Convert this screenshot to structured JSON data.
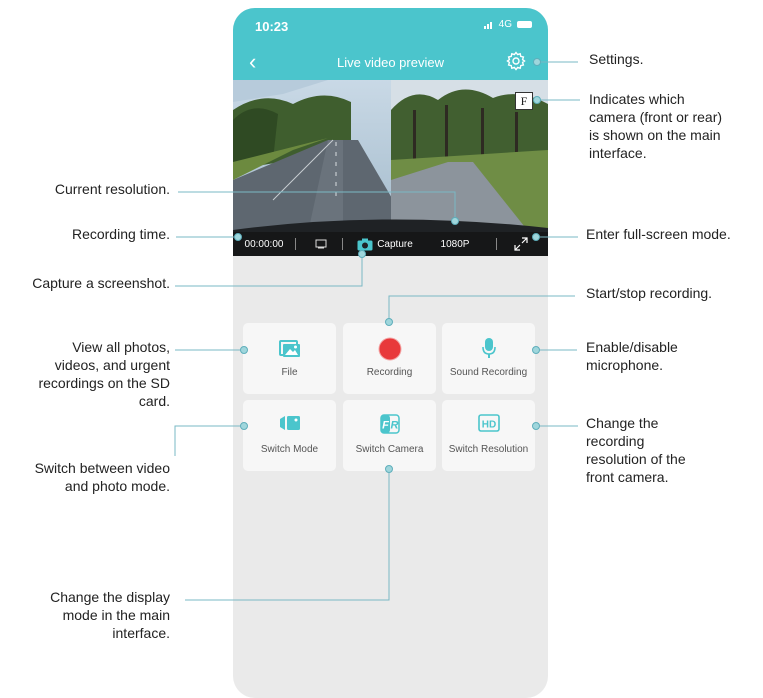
{
  "phone": {
    "time": "10:23",
    "network": "4G",
    "nav_title": "Live video preview",
    "camera_badge": "F",
    "recording_time": "00:00:00",
    "capture_label": "Capture",
    "resolution": "1080P"
  },
  "tiles": [
    {
      "label": "File",
      "icon": "photo-gallery-icon"
    },
    {
      "label": "Recording",
      "icon": "record-dot-icon"
    },
    {
      "label": "Sound Recording",
      "icon": "microphone-icon"
    },
    {
      "label": "Switch Mode",
      "icon": "video-camera-icon"
    },
    {
      "label": "Switch Camera",
      "icon": "front-rear-icon"
    },
    {
      "label": "Switch Resolution",
      "icon": "hd-icon"
    }
  ],
  "annotations": {
    "settings": "Settings.",
    "camera_shown": [
      "Indicates which",
      "camera (front or rear)",
      "is shown on the main",
      "interface."
    ],
    "current_resolution": "Current resolution.",
    "recording_time": "Recording time.",
    "fullscreen": "Enter full-screen mode.",
    "capture": "Capture a screenshot.",
    "start_stop": "Start/stop recording.",
    "view_all": [
      "View all photos,",
      "videos, and urgent",
      "recordings on the SD",
      "card."
    ],
    "microphone": [
      "Enable/disable",
      "microphone."
    ],
    "switch_mode": [
      "Switch between video",
      "and photo mode."
    ],
    "change_resolution": [
      "Change the",
      "recording",
      "resolution of the",
      "front camera."
    ],
    "display_mode": [
      "Change the display",
      "mode in the main",
      "interface."
    ]
  },
  "colors": {
    "accent": "#4bc5cc",
    "record": "#e8393b",
    "leader": "#7ab8c4"
  }
}
